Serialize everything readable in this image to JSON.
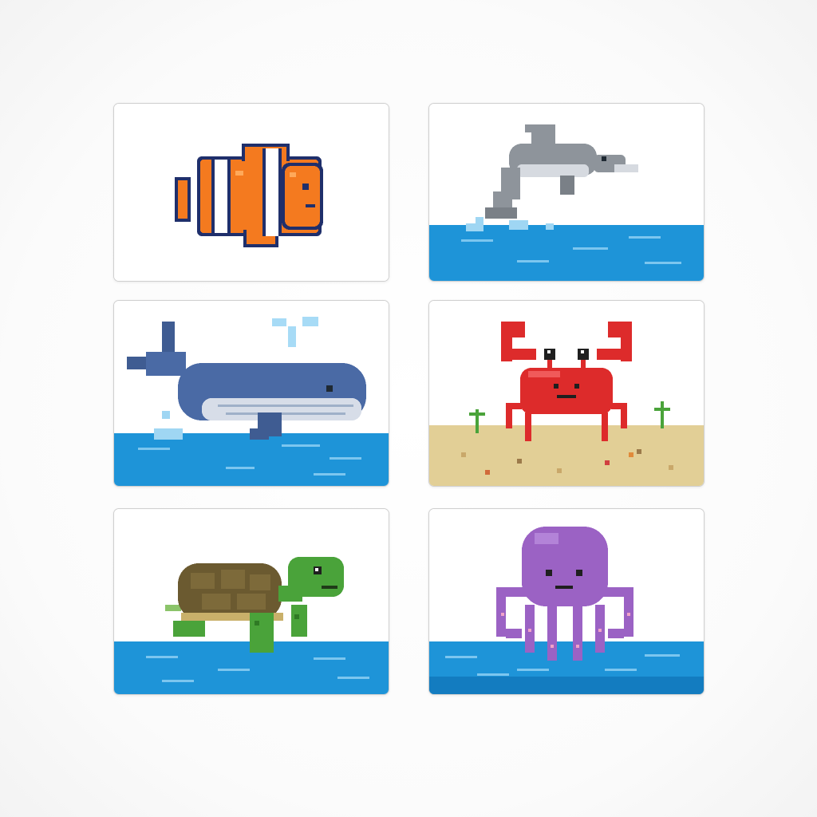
{
  "cards": [
    {
      "animal": "clownfish-icon",
      "scene": "plain"
    },
    {
      "animal": "dolphin-icon",
      "scene": "water"
    },
    {
      "animal": "whale-icon",
      "scene": "water"
    },
    {
      "animal": "crab-icon",
      "scene": "sand"
    },
    {
      "animal": "turtle-icon",
      "scene": "water"
    },
    {
      "animal": "octopus-icon",
      "scene": "water"
    }
  ],
  "colors": {
    "water": "#1e94d8",
    "water_dark": "#137cc0",
    "sand": "#e2cf96",
    "card_border": "#cfcfcf",
    "clownfish_orange": "#f47a1f",
    "dolphin_gray": "#8e949b",
    "whale_blue": "#4a6aa5",
    "crab_red": "#dd2b2b",
    "turtle_green": "#4aa33a",
    "turtle_shell": "#6b5a30",
    "octopus_purple": "#9b62c4"
  }
}
